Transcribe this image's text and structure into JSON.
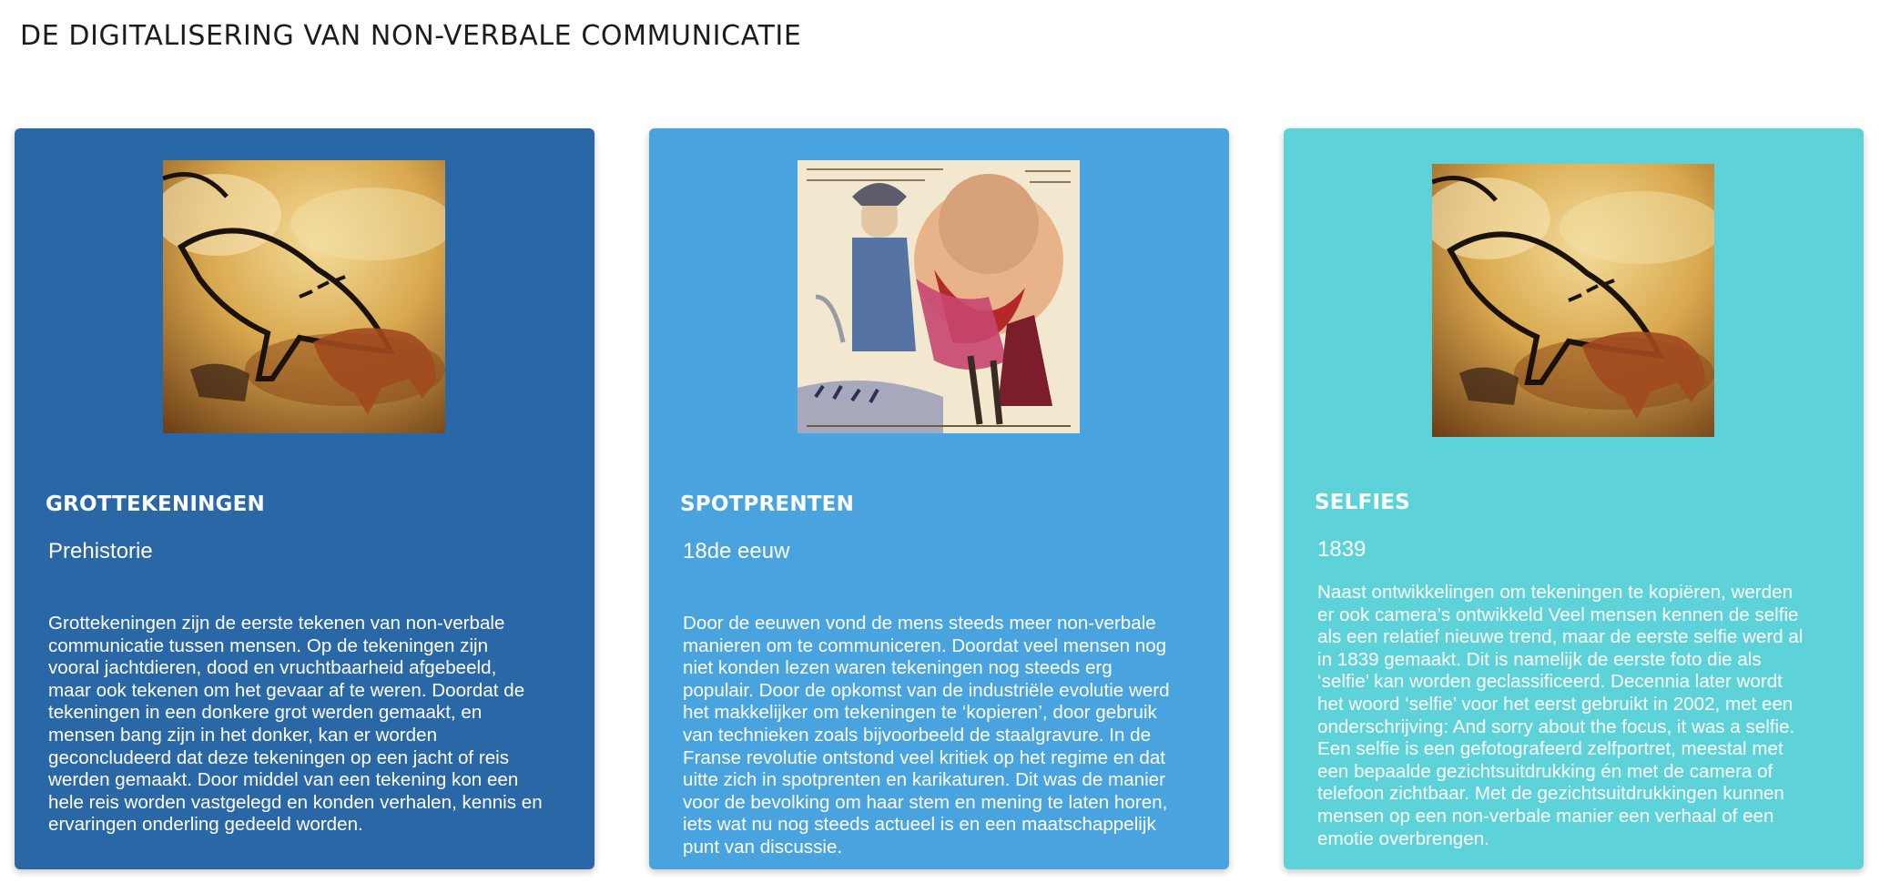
{
  "page": {
    "title": "DE DIGITALISERING VAN NON-VERBALE COMMUNICATIE"
  },
  "colors": {
    "card_1_background": "#2a67a7",
    "card_2_background": "#48a3df",
    "card_3_background": "#5dd3d9",
    "text": "#ffffff"
  },
  "cards": [
    {
      "title": "GROTTEKENINGEN",
      "period": "Prehistorie",
      "image_icon": "cave-painting-image",
      "body_lines": [
        "Grottekeningen zijn de eerste tekenen van non-verbale",
        "communicatie tussen mensen. Op de tekeningen zijn",
        "vooral jachtdieren, dood en vruchtbaarheid afgebeeld,",
        "maar ook tekenen om het gevaar af te weren. Doordat de",
        "tekeningen in een donkere grot werden gemaakt, en",
        "mensen bang zijn in het donker, kan er worden",
        "geconcludeerd dat deze tekeningen op een jacht of reis",
        "werden gemaakt. Door middel van een tekening kon een",
        "hele reis worden vastgelegd en konden verhalen, kennis en",
        "ervaringen onderling gedeeld worden."
      ]
    },
    {
      "title": "SPOTPRENTEN",
      "period": "18de eeuw",
      "image_icon": "caricature-print-image",
      "body_lines": [
        "Door de eeuwen vond de mens steeds meer non-verbale",
        "manieren om te communiceren. Doordat veel mensen nog",
        "niet konden lezen waren tekeningen nog steeds erg",
        "populair. Door de opkomst van de industriële evolutie werd",
        "het makkelijker om tekeningen te ‘kopieren’, door gebruik",
        "van technieken zoals bijvoorbeeld de staalgravure. In de",
        "Franse revolutie ontstond veel kritiek op het regime en dat",
        "uitte zich in spotprenten en karikaturen. Dit was de manier",
        "voor de bevolking om haar stem en mening te laten horen,",
        "iets wat nu nog steeds actueel is en een maatschappelijk",
        "punt van discussie."
      ]
    },
    {
      "title": "SELFIES",
      "period": "1839",
      "image_icon": "cave-painting-image",
      "body_lines": [
        "Naast ontwikkelingen om tekeningen te kopiëren, werden",
        "er ook camera’s ontwikkeld Veel mensen kennen de selfie",
        "als een relatief nieuwe trend, maar de eerste selfie werd al",
        "in 1839 gemaakt. Dit is namelijk de eerste foto die als",
        "‘selfie’ kan worden geclassificeerd. Decennia later wordt",
        "het woord ‘selfie’ voor het eerst gebruikt in 2002, met een",
        "onderschrijving: And sorry about the focus, it was a selfie.",
        "Een selfie is een gefotografeerd zelfportret, meestal met",
        "een bepaalde gezichtsuitdrukking én met de camera of",
        "telefoon zichtbaar. Met de gezichtsuitdrukkingen kunnen",
        "mensen op een non-verbale manier een verhaal of een",
        "emotie overbrengen."
      ]
    }
  ]
}
